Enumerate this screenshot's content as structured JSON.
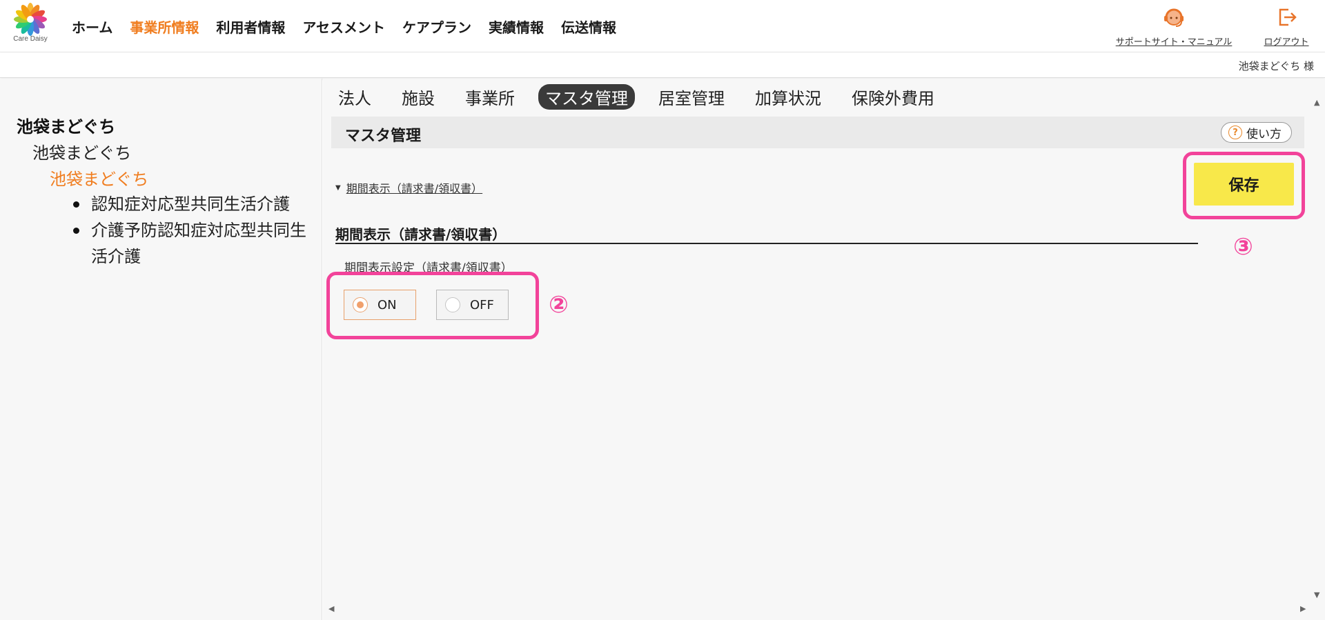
{
  "header": {
    "logo_text": "Care Daisy",
    "nav": [
      {
        "label": "ホーム",
        "active": false
      },
      {
        "label": "事業所情報",
        "active": true
      },
      {
        "label": "利用者情報",
        "active": false
      },
      {
        "label": "アセスメント",
        "active": false
      },
      {
        "label": "ケアプラン",
        "active": false
      },
      {
        "label": "実績情報",
        "active": false
      },
      {
        "label": "伝送情報",
        "active": false
      }
    ],
    "support_label": "サポートサイト・マニュアル",
    "logout_label": "ログアウト",
    "user_name": "池袋まどぐち 様"
  },
  "sidebar": {
    "root": "池袋まどぐち",
    "level1": "池袋まどぐち",
    "level2": "池袋まどぐち",
    "services": [
      "認知症対応型共同生活介護",
      "介護予防認知症対応型共同生活介護"
    ]
  },
  "subnav": [
    {
      "label": "法人",
      "active": false
    },
    {
      "label": "施設",
      "active": false
    },
    {
      "label": "事業所",
      "active": false
    },
    {
      "label": "マスタ管理",
      "active": true
    },
    {
      "label": "居室管理",
      "active": false
    },
    {
      "label": "加算状況",
      "active": false
    },
    {
      "label": "保険外費用",
      "active": false
    }
  ],
  "main": {
    "title": "マスタ管理",
    "howto_label": "使い方",
    "collapse_label": "期間表示（請求書/領収書）",
    "save_label": "保存",
    "section_title": "期間表示（請求書/領収書）",
    "field_label": "期間表示設定（請求書/領収書）",
    "radio_options": [
      {
        "label": "ON",
        "checked": true
      },
      {
        "label": "OFF",
        "checked": false
      }
    ],
    "annotation_2": "②",
    "annotation_3": "③"
  },
  "colors": {
    "accent_orange": "#f07d1f",
    "highlight_pink": "#f2439a",
    "save_yellow": "#f8e84a"
  }
}
